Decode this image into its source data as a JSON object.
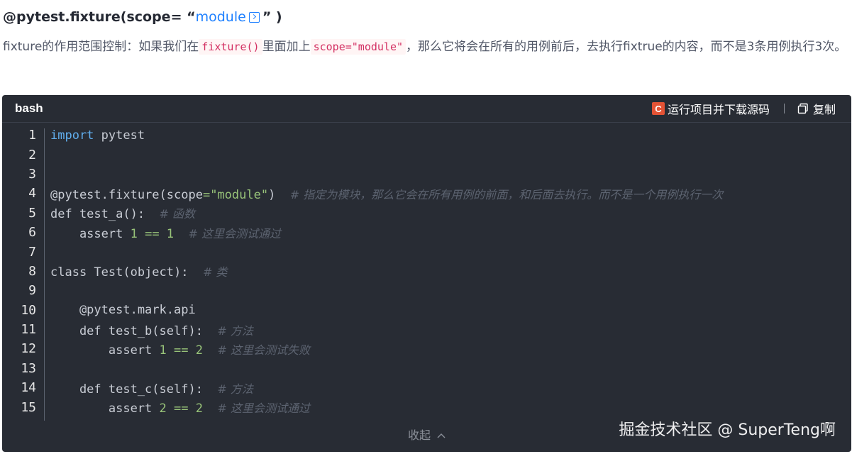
{
  "heading": {
    "prefix": "@pytest.fixture(scope= “",
    "link": "module",
    "suffix": "” )"
  },
  "paragraph": {
    "part1": "fixture的作用范围控制：如果我们在",
    "code1": "fixture()",
    "part2": "里面加上",
    "code2": "scope=\"module\"",
    "part3": "，那么它将会在所有的用例前后，去执行fixtrue的内容，而不是3条用例执行3次。"
  },
  "code_block": {
    "language": "bash",
    "run_label": "运行项目并下载源码",
    "copy_label": "复制",
    "collapse_label": "收起",
    "watermark": "掘金技术社区 @ SuperTeng啊",
    "lines": [
      {
        "n": "1"
      },
      {
        "n": "2"
      },
      {
        "n": "3"
      },
      {
        "n": "4"
      },
      {
        "n": "5"
      },
      {
        "n": "6"
      },
      {
        "n": "7"
      },
      {
        "n": "8"
      },
      {
        "n": "9"
      },
      {
        "n": "10"
      },
      {
        "n": "11"
      },
      {
        "n": "12"
      },
      {
        "n": "13"
      },
      {
        "n": "14"
      },
      {
        "n": "15"
      }
    ],
    "tokens": {
      "l1_kw": "import",
      "l1_rest": " pytest",
      "l4_a": "@pytest.fixture(scope",
      "l4_eq": "=",
      "l4_str": "\"module\"",
      "l4_b": ")  ",
      "l4_cm": "# 指定为模块，那么它会在所有用例的前面，和后面去执行。而不是一个用例执行一次",
      "l5_a": "def test_a():  ",
      "l5_cm": "# 函数",
      "l6_a": "    assert ",
      "l6_n1": "1",
      "l6_op": " == ",
      "l6_n2": "1",
      "l6_sp": "  ",
      "l6_cm": "# 这里会测试通过",
      "l8_a": "class Test(object):  ",
      "l8_cm": "# 类",
      "l10_a": "    @pytest.mark.api",
      "l11_a": "    def test_b(self):  ",
      "l11_cm": "# 方法",
      "l12_a": "        assert ",
      "l12_n1": "1",
      "l12_op": " == ",
      "l12_n2": "2",
      "l12_sp": "  ",
      "l12_cm": "# 这里会测试失败",
      "l14_a": "    def test_c(self):  ",
      "l14_cm": "# 方法",
      "l15_a": "        assert ",
      "l15_n1": "2",
      "l15_op": " == ",
      "l15_n2": "2",
      "l15_sp": "  ",
      "l15_cm": "# 这里会测试通过"
    }
  },
  "colors": {
    "code_bg": "#282c34",
    "link": "#1e80ff",
    "keyword": "#61afef",
    "string": "#98c379",
    "comment": "#5c6370",
    "run_icon": "#e45335"
  },
  "icons": {
    "run": "c-logo-icon",
    "copy": "copy-icon",
    "external": "external-link-icon",
    "collapse": "chevron-up-icon"
  }
}
